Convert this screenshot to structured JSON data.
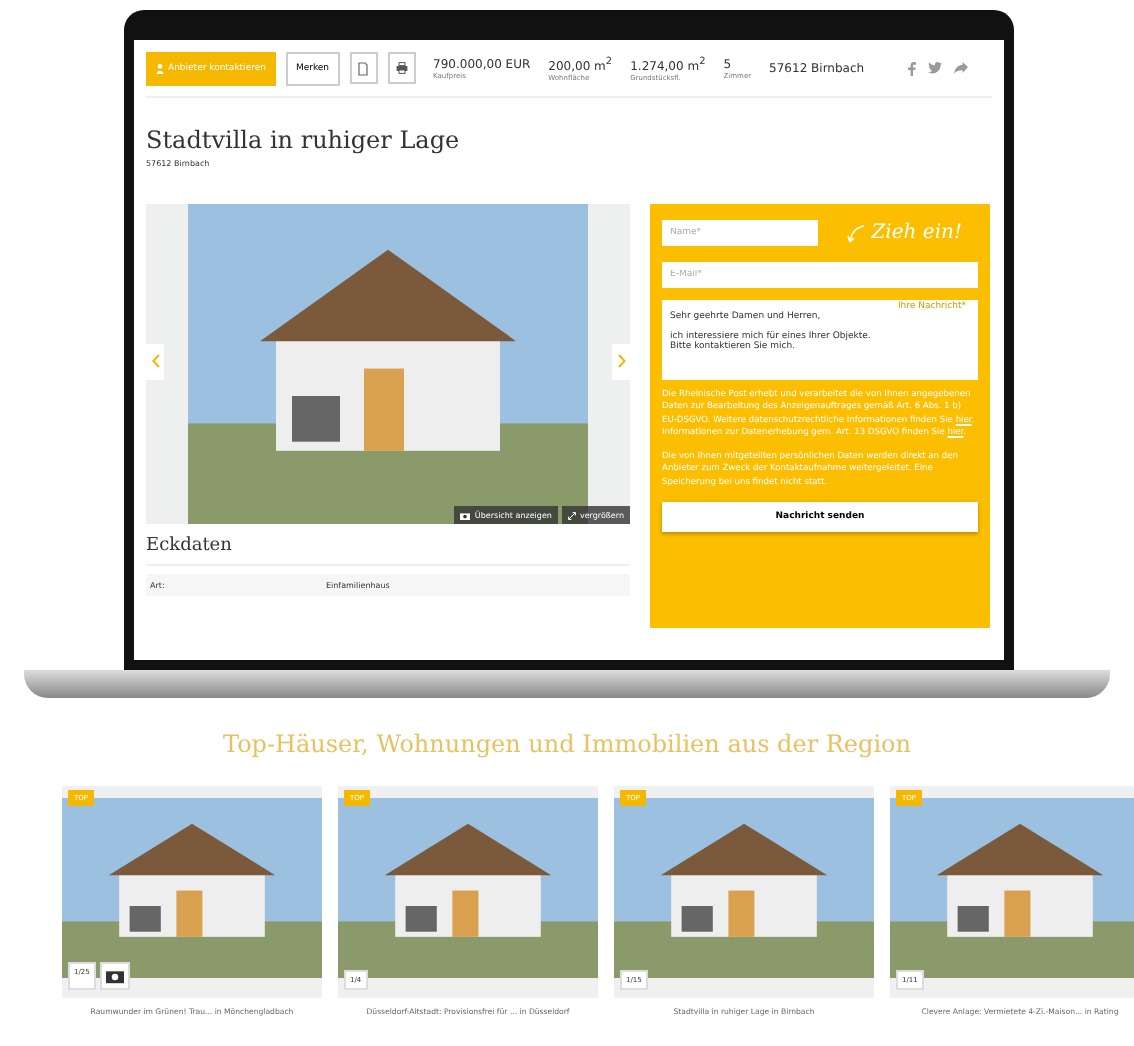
{
  "toolbar": {
    "contact_button": "Anbieter kontaktieren",
    "save_button": "Merken",
    "facts": [
      {
        "value": "790.000,00 EUR",
        "label": "Kaufpreis"
      },
      {
        "value": "200,00 m$^{2}$",
        "label": "Wohnfläche"
      },
      {
        "value": "1.274,00 m$^{2}$",
        "label": "Grundstücksfl."
      },
      {
        "value": "5",
        "label": "Zimmer"
      },
      {
        "value": "57612 Birnbach"
      }
    ]
  },
  "listing": {
    "title": "Stadtvilla in ruhiger Lage",
    "location": "57612 Birnbach"
  },
  "gallery": {
    "overview_button": "Übersicht anzeigen",
    "zoom_button": "vergrößern"
  },
  "key_data": {
    "heading": "Eckdaten",
    "rows": [
      {
        "label": "Art:",
        "value": "Einfamilienhaus"
      }
    ]
  },
  "contact_form": {
    "slogan": "Zieh ein!",
    "name_placeholder": "Name*",
    "email_placeholder": "E-Mail*",
    "message_label": "Ihre Nachricht*",
    "message": "Sehr geehrte Damen und Herren,\n\nich interessiere mich für eines Ihrer Objekte.\nBitte kontaktieren Sie mich.",
    "privacy": [
      {
        "kind": "text",
        "text": "Die Rheinische Post erhebt und verarbeitet die von Ihnen angegebenen Daten zur Bearbeitung des Anzeigenauftrages gemäß Art. 6 Abs. 1 b) EU-DSGVO. Weitere datenschutzrechtliche Informationen finden Sie "
      },
      {
        "kind": "link",
        "text": "hier"
      },
      {
        "kind": "text",
        "text": ". Informationen zur Datenerhebung gem. Art. 13 DSGVO finden Sie "
      },
      {
        "kind": "link",
        "text": "hier"
      },
      {
        "kind": "text",
        "text": "."
      }
    ],
    "notice": "Die von Ihnen mitgeteilten persönlichen Daten werden direkt an den Anbieter zum Zweck der Kontaktaufnahme weitergeleitet. Eine Speicherung bei uns findet nicht statt.",
    "submit_button": "Nachricht senden"
  },
  "top_listings": {
    "heading": "Top-Häuser, Wohnungen und Immobilien aus der Region",
    "cards": [
      {
        "badge": "TOP",
        "count": "1/25",
        "has_camera": true,
        "caption": "Raumwunder im Grünen! Trau... in Mönchengladbach"
      },
      {
        "badge": "TOP",
        "count": "1/4",
        "has_camera": false,
        "caption": "Düsseldorf-Altstadt: Provisionsfrei für ... in Düsseldorf"
      },
      {
        "badge": "TOP",
        "count": "1/15",
        "has_camera": false,
        "caption": "Stadtvilla in ruhiger Lage in Birnbach"
      },
      {
        "badge": "TOP",
        "count": "1/11",
        "has_camera": false,
        "caption": "Clevere Anlage: Vermietete 4-Zi.-Maison... in Rating"
      }
    ]
  }
}
